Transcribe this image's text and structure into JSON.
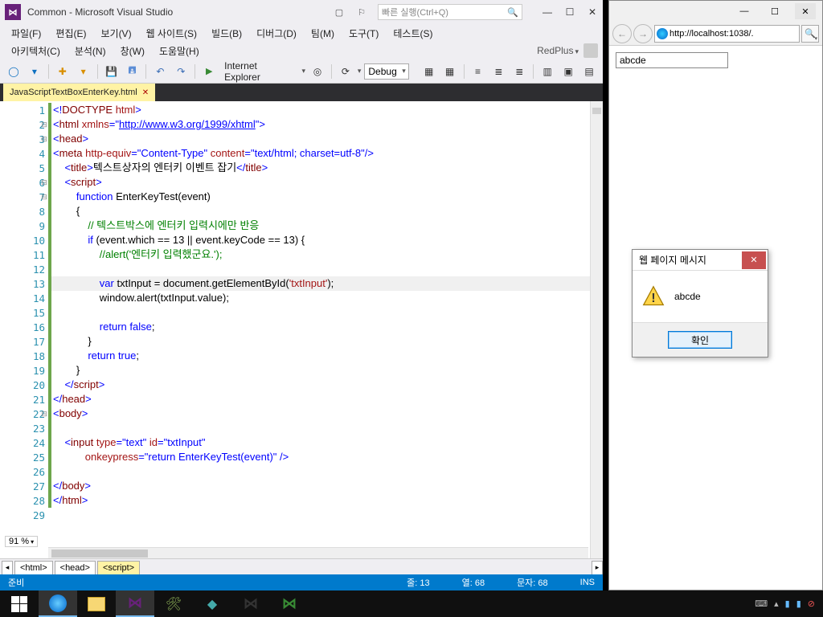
{
  "vs": {
    "title": "Common - Microsoft Visual Studio",
    "search_placeholder": "빠른 실행(Ctrl+Q)",
    "menu1": [
      "파일(F)",
      "편집(E)",
      "보기(V)",
      "웹 사이트(S)",
      "빌드(B)",
      "디버그(D)",
      "팀(M)",
      "도구(T)",
      "테스트(S)"
    ],
    "menu2": [
      "아키텍처(C)",
      "분석(N)",
      "창(W)",
      "도움말(H)"
    ],
    "account": "RedPlus",
    "toolbar": {
      "browser": "Internet Explorer",
      "config": "Debug"
    },
    "tab": {
      "name": "JavaScriptTextBoxEnterKey.html"
    },
    "zoom": "91 %",
    "nav_chips": [
      "<html>",
      "<head>",
      "<script>"
    ],
    "status": {
      "ready": "준비",
      "line": "줄: 13",
      "col": "열: 68",
      "char": "문자: 68",
      "ins": "INS"
    },
    "code": {
      "lines": [
        {
          "n": 1,
          "g": true
        },
        {
          "n": 2,
          "g": true,
          "m": "⊟"
        },
        {
          "n": 3,
          "g": true,
          "m": "⊟"
        },
        {
          "n": 4,
          "g": true
        },
        {
          "n": 5,
          "g": true
        },
        {
          "n": 6,
          "g": true,
          "m": "⊟"
        },
        {
          "n": 7,
          "g": true,
          "m": "⊟"
        },
        {
          "n": 8,
          "g": true
        },
        {
          "n": 9,
          "g": true
        },
        {
          "n": 10,
          "g": true
        },
        {
          "n": 11,
          "g": true
        },
        {
          "n": 12,
          "g": true
        },
        {
          "n": 13,
          "g": true,
          "hl": true
        },
        {
          "n": 14,
          "g": true
        },
        {
          "n": 15,
          "g": true
        },
        {
          "n": 16,
          "g": true
        },
        {
          "n": 17,
          "g": true
        },
        {
          "n": 18,
          "g": true
        },
        {
          "n": 19,
          "g": true
        },
        {
          "n": 20,
          "g": true
        },
        {
          "n": 21,
          "g": true
        },
        {
          "n": 22,
          "g": true,
          "m": "⊟"
        },
        {
          "n": 23,
          "g": true
        },
        {
          "n": 24,
          "g": true
        },
        {
          "n": 25,
          "g": true
        },
        {
          "n": 26,
          "g": true
        },
        {
          "n": 27,
          "g": true
        },
        {
          "n": 28,
          "g": true
        },
        {
          "n": 29
        }
      ]
    }
  },
  "ie": {
    "url": "http://localhost:1038/.",
    "input_value": "abcde"
  },
  "alert": {
    "title": "웹 페이지 메시지",
    "message": "abcde",
    "ok": "확인"
  }
}
